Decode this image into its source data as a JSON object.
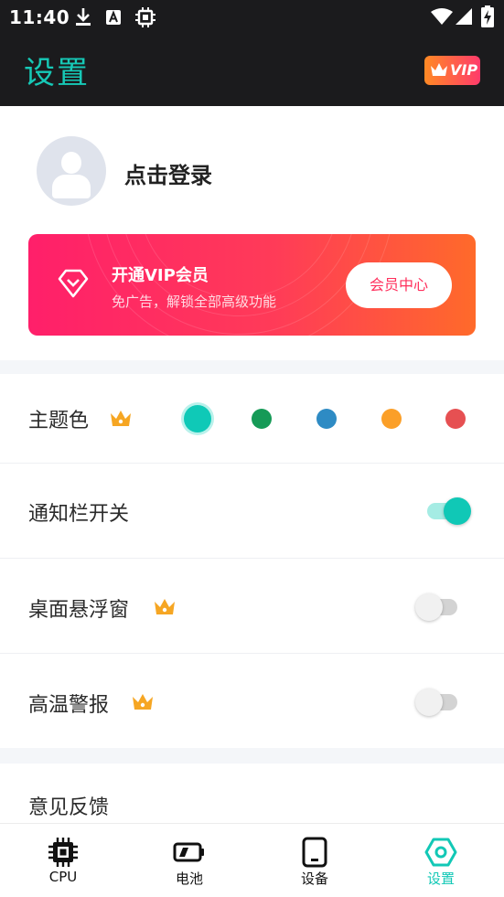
{
  "status_bar": {
    "time": "11:40"
  },
  "header": {
    "title": "设置",
    "vip_badge": "VIP"
  },
  "profile": {
    "login_label": "点击登录"
  },
  "vip_banner": {
    "title": "开通VIP会员",
    "subtitle": "免广告，解锁全部高级功能",
    "button_label": "会员中心"
  },
  "settings": {
    "theme": {
      "label": "主题色",
      "selected": "teal",
      "colors": [
        "#0fc9b7",
        "#169a57",
        "#2e8bc4",
        "#fb9f28",
        "#e65052"
      ]
    },
    "notification": {
      "label": "通知栏开关",
      "enabled": true
    },
    "floating_window": {
      "label": "桌面悬浮窗",
      "enabled": false
    },
    "high_temp_alert": {
      "label": "高温警报",
      "enabled": false
    },
    "feedback": {
      "label": "意见反馈"
    }
  },
  "bottom_nav": {
    "items": [
      {
        "label": "CPU",
        "icon": "cpu-icon"
      },
      {
        "label": "电池",
        "icon": "battery-icon"
      },
      {
        "label": "设备",
        "icon": "device-icon"
      },
      {
        "label": "设置",
        "icon": "settings-icon",
        "active": true
      }
    ]
  },
  "colors": {
    "accent": "#12c8b6",
    "vip_gradient_start": "#ff1f6a",
    "vip_gradient_end": "#ff6a2a",
    "crown": "#f6a623"
  }
}
